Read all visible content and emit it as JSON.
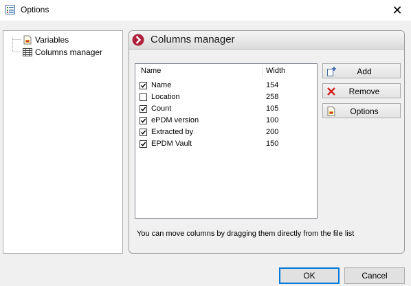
{
  "window": {
    "title": "Options",
    "close_glyph": "✕"
  },
  "tree": {
    "items": [
      {
        "label": "Variables",
        "icon": "variables-icon"
      },
      {
        "label": "Columns manager",
        "icon": "table-icon"
      }
    ]
  },
  "panel": {
    "title": "Columns manager",
    "list": {
      "headers": {
        "name": "Name",
        "width": "Width"
      },
      "rows": [
        {
          "name": "Name",
          "width": "154",
          "checked": true
        },
        {
          "name": "Location",
          "width": "258",
          "checked": false
        },
        {
          "name": "Count",
          "width": "105",
          "checked": true
        },
        {
          "name": "ePDM version",
          "width": "100",
          "checked": true
        },
        {
          "name": "Extracted by",
          "width": "200",
          "checked": true
        },
        {
          "name": "EPDM Vault",
          "width": "150",
          "checked": true
        }
      ]
    },
    "buttons": {
      "add": "Add",
      "remove": "Remove",
      "options": "Options"
    },
    "hint": "You can move columns by dragging them directly from the file list"
  },
  "footer": {
    "ok": "OK",
    "cancel": "Cancel"
  },
  "colors": {
    "accent": "#0078d7",
    "header_icon": "#b0203a",
    "remove_icon": "#d42020"
  }
}
